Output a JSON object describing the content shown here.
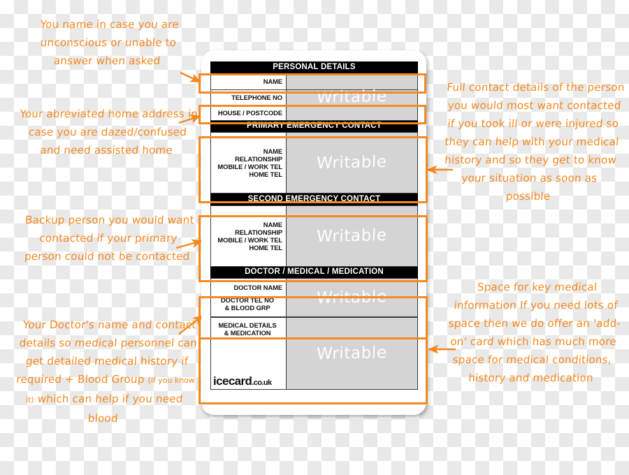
{
  "card": {
    "brand": "icecard",
    "brand_tld": ".co.uk",
    "writable_label": "Writable",
    "sections": [
      {
        "id": "personal-details",
        "header": "PERSONAL DETAILS",
        "rows": [
          {
            "id": "name",
            "labels": [
              "NAME"
            ]
          },
          {
            "id": "telephone-no",
            "labels": [
              "TELEPHONE NO"
            ]
          },
          {
            "id": "house-postcode",
            "labels": [
              "HOUSE / POSTCODE"
            ]
          }
        ]
      },
      {
        "id": "primary-emergency-contact",
        "header": "PRIMARY EMERGENCY CONTACT",
        "rows": [
          {
            "id": "primary-contact",
            "labels": [
              "NAME",
              "RELATIONSHIP",
              "MOBILE / WORK TEL",
              "HOME TEL"
            ]
          }
        ]
      },
      {
        "id": "second-emergency-contact",
        "header": "SECOND EMERGENCY CONTACT",
        "rows": [
          {
            "id": "second-contact",
            "labels": [
              "NAME",
              "RELATIONSHIP",
              "MOBILE / WORK TEL",
              "HOME TEL"
            ]
          }
        ]
      },
      {
        "id": "doctor-medical-medication",
        "header": "DOCTOR / MEDICAL / MEDICATION",
        "rows": [
          {
            "id": "doctor",
            "labels": [
              "DOCTOR NAME",
              "DOCTOR TEL NO",
              "& BLOOD GRP"
            ]
          },
          {
            "id": "medical",
            "labels": [
              "MEDICAL DETAILS",
              "& MEDICATION"
            ]
          }
        ]
      }
    ]
  },
  "annotations": {
    "name": "You name in case you are unconscious or unable to answer when asked",
    "address": "Your abreviated home address in case you are dazed/confused and need assisted home",
    "backup": "Backup person you would want contacted if your primary person could not be contacted",
    "doctor_main": "Your Doctor's name and contact details so medical personnel can get detailed medical history if required + Blood Group ",
    "doctor_paren": "(if you know it)",
    "doctor_tail": " which can help if you need blood",
    "primary": "Full contact details of the person you would most want contacted if you took ill or were injured so they can help with your medical history and so they get to know your situation as soon as possible",
    "medical": "Space for key medical information If you need lots of space then we do offer an 'add-on' card which has much more space for medical conditions, history and medication"
  },
  "colors": {
    "accent": "#F5891F",
    "header_bg": "#000000",
    "writable_bg": "#d4d4d4",
    "card_bg": "#ffffff"
  }
}
